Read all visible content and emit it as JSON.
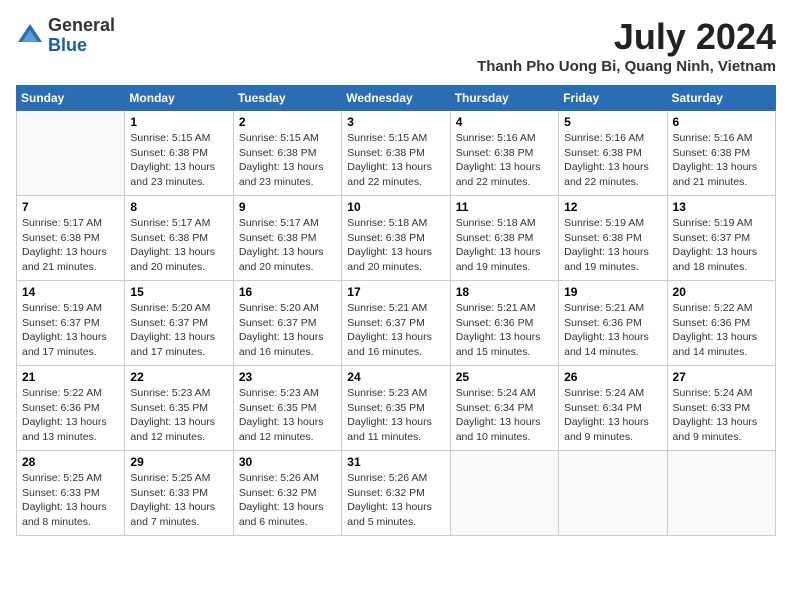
{
  "logo": {
    "general": "General",
    "blue": "Blue"
  },
  "header": {
    "month": "July 2024",
    "location": "Thanh Pho Uong Bi, Quang Ninh, Vietnam"
  },
  "weekdays": [
    "Sunday",
    "Monday",
    "Tuesday",
    "Wednesday",
    "Thursday",
    "Friday",
    "Saturday"
  ],
  "weeks": [
    [
      {
        "day": "",
        "info": ""
      },
      {
        "day": "1",
        "info": "Sunrise: 5:15 AM\nSunset: 6:38 PM\nDaylight: 13 hours\nand 23 minutes."
      },
      {
        "day": "2",
        "info": "Sunrise: 5:15 AM\nSunset: 6:38 PM\nDaylight: 13 hours\nand 23 minutes."
      },
      {
        "day": "3",
        "info": "Sunrise: 5:15 AM\nSunset: 6:38 PM\nDaylight: 13 hours\nand 22 minutes."
      },
      {
        "day": "4",
        "info": "Sunrise: 5:16 AM\nSunset: 6:38 PM\nDaylight: 13 hours\nand 22 minutes."
      },
      {
        "day": "5",
        "info": "Sunrise: 5:16 AM\nSunset: 6:38 PM\nDaylight: 13 hours\nand 22 minutes."
      },
      {
        "day": "6",
        "info": "Sunrise: 5:16 AM\nSunset: 6:38 PM\nDaylight: 13 hours\nand 21 minutes."
      }
    ],
    [
      {
        "day": "7",
        "info": "Sunrise: 5:17 AM\nSunset: 6:38 PM\nDaylight: 13 hours\nand 21 minutes."
      },
      {
        "day": "8",
        "info": "Sunrise: 5:17 AM\nSunset: 6:38 PM\nDaylight: 13 hours\nand 20 minutes."
      },
      {
        "day": "9",
        "info": "Sunrise: 5:17 AM\nSunset: 6:38 PM\nDaylight: 13 hours\nand 20 minutes."
      },
      {
        "day": "10",
        "info": "Sunrise: 5:18 AM\nSunset: 6:38 PM\nDaylight: 13 hours\nand 20 minutes."
      },
      {
        "day": "11",
        "info": "Sunrise: 5:18 AM\nSunset: 6:38 PM\nDaylight: 13 hours\nand 19 minutes."
      },
      {
        "day": "12",
        "info": "Sunrise: 5:19 AM\nSunset: 6:38 PM\nDaylight: 13 hours\nand 19 minutes."
      },
      {
        "day": "13",
        "info": "Sunrise: 5:19 AM\nSunset: 6:37 PM\nDaylight: 13 hours\nand 18 minutes."
      }
    ],
    [
      {
        "day": "14",
        "info": "Sunrise: 5:19 AM\nSunset: 6:37 PM\nDaylight: 13 hours\nand 17 minutes."
      },
      {
        "day": "15",
        "info": "Sunrise: 5:20 AM\nSunset: 6:37 PM\nDaylight: 13 hours\nand 17 minutes."
      },
      {
        "day": "16",
        "info": "Sunrise: 5:20 AM\nSunset: 6:37 PM\nDaylight: 13 hours\nand 16 minutes."
      },
      {
        "day": "17",
        "info": "Sunrise: 5:21 AM\nSunset: 6:37 PM\nDaylight: 13 hours\nand 16 minutes."
      },
      {
        "day": "18",
        "info": "Sunrise: 5:21 AM\nSunset: 6:36 PM\nDaylight: 13 hours\nand 15 minutes."
      },
      {
        "day": "19",
        "info": "Sunrise: 5:21 AM\nSunset: 6:36 PM\nDaylight: 13 hours\nand 14 minutes."
      },
      {
        "day": "20",
        "info": "Sunrise: 5:22 AM\nSunset: 6:36 PM\nDaylight: 13 hours\nand 14 minutes."
      }
    ],
    [
      {
        "day": "21",
        "info": "Sunrise: 5:22 AM\nSunset: 6:36 PM\nDaylight: 13 hours\nand 13 minutes."
      },
      {
        "day": "22",
        "info": "Sunrise: 5:23 AM\nSunset: 6:35 PM\nDaylight: 13 hours\nand 12 minutes."
      },
      {
        "day": "23",
        "info": "Sunrise: 5:23 AM\nSunset: 6:35 PM\nDaylight: 13 hours\nand 12 minutes."
      },
      {
        "day": "24",
        "info": "Sunrise: 5:23 AM\nSunset: 6:35 PM\nDaylight: 13 hours\nand 11 minutes."
      },
      {
        "day": "25",
        "info": "Sunrise: 5:24 AM\nSunset: 6:34 PM\nDaylight: 13 hours\nand 10 minutes."
      },
      {
        "day": "26",
        "info": "Sunrise: 5:24 AM\nSunset: 6:34 PM\nDaylight: 13 hours\nand 9 minutes."
      },
      {
        "day": "27",
        "info": "Sunrise: 5:24 AM\nSunset: 6:33 PM\nDaylight: 13 hours\nand 9 minutes."
      }
    ],
    [
      {
        "day": "28",
        "info": "Sunrise: 5:25 AM\nSunset: 6:33 PM\nDaylight: 13 hours\nand 8 minutes."
      },
      {
        "day": "29",
        "info": "Sunrise: 5:25 AM\nSunset: 6:33 PM\nDaylight: 13 hours\nand 7 minutes."
      },
      {
        "day": "30",
        "info": "Sunrise: 5:26 AM\nSunset: 6:32 PM\nDaylight: 13 hours\nand 6 minutes."
      },
      {
        "day": "31",
        "info": "Sunrise: 5:26 AM\nSunset: 6:32 PM\nDaylight: 13 hours\nand 5 minutes."
      },
      {
        "day": "",
        "info": ""
      },
      {
        "day": "",
        "info": ""
      },
      {
        "day": "",
        "info": ""
      }
    ]
  ]
}
